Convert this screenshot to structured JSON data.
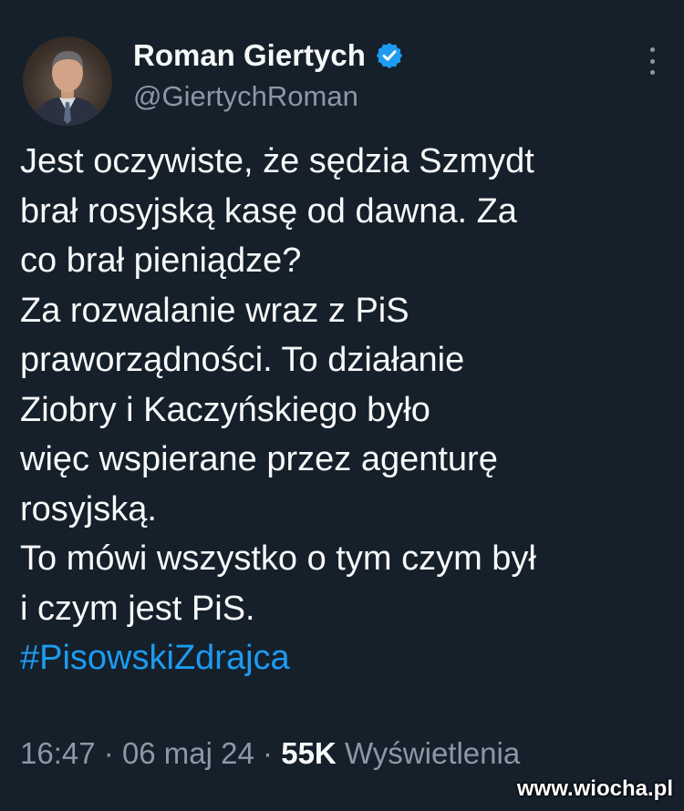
{
  "author": {
    "display_name": "Roman Giertych",
    "handle": "@GiertychRoman",
    "verified_color": "#1d9bf0"
  },
  "menu_icon": "more-vertical-icon",
  "tweet": {
    "lines": [
      "Jest oczywiste, że sędzia Szmydt",
      "brał rosyjską kasę od dawna. Za",
      "co brał pieniądze?",
      "Za rozwalanie wraz z PiS",
      "praworządności. To działanie",
      "Ziobry i Kaczyńskiego było",
      "więc wspierane przez agenturę",
      "rosyjską.",
      "To mówi wszystko o tym czym był",
      "i czym jest PiS."
    ],
    "hashtag": "#PisowskiZdrajca"
  },
  "meta": {
    "time": "16:47",
    "separator": "·",
    "date": "06 maj 24",
    "views_count": "55K",
    "views_label": "Wyświetlenia"
  },
  "watermark": "www.wiocha.pl",
  "colors": {
    "background": "#15202b",
    "text": "#f7f9f9",
    "secondary": "#8b98a5",
    "link": "#1d9bf0"
  }
}
